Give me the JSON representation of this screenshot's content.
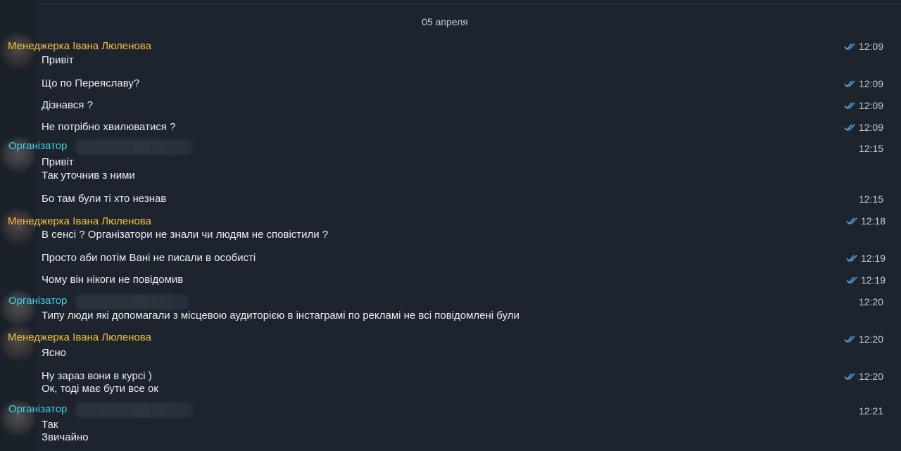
{
  "date_separator": "05 апреля",
  "senders": {
    "manager": "Менеджерка Івана Люленова",
    "organizer": "Організатор"
  },
  "messages": [
    {
      "text": "Привіт",
      "time": "12:09",
      "read": true
    },
    {
      "text": "Що по Переяславу?",
      "time": "12:09",
      "read": true
    },
    {
      "text": "Дізнався ?",
      "time": "12:09",
      "read": true
    },
    {
      "text": "Не потрібно хвилюватися ?",
      "time": "12:09",
      "read": true
    },
    {
      "line1": "Привіт",
      "line2": "Так уточнив з ними",
      "time": "12:15"
    },
    {
      "text": "Бо там були ті хто незнав",
      "time": "12:15"
    },
    {
      "text": "В сенсі ? Організатори не знали чи людям не сповістили ?",
      "time": "12:18",
      "read": true
    },
    {
      "text": "Просто аби потім Вані не писали в особисті",
      "time": "12:19",
      "read": true
    },
    {
      "text": "Чому він нікоги не повідомив",
      "time": "12:19",
      "read": true
    },
    {
      "text": "Типу люди які допомагали з місцевою аудиторією в інстаграмі по рекламі не всі повідомлені були",
      "time": "12:20"
    },
    {
      "text": "Ясно",
      "time": "12:20",
      "read": true
    },
    {
      "line1": "Ну зараз вони в курсі )",
      "line2": "Ок, тоді має бути все ок",
      "time": "12:20",
      "read": true
    },
    {
      "line1": "Так",
      "line2": "Звичайно",
      "time": "12:21"
    }
  ],
  "colors": {
    "background": "#1d242e",
    "manager_name": "#f5c33b",
    "organizer_name": "#3fd3e6",
    "read_ticks": "#5aa7e8"
  },
  "icons": {
    "read_receipt": "double-check-icon"
  }
}
